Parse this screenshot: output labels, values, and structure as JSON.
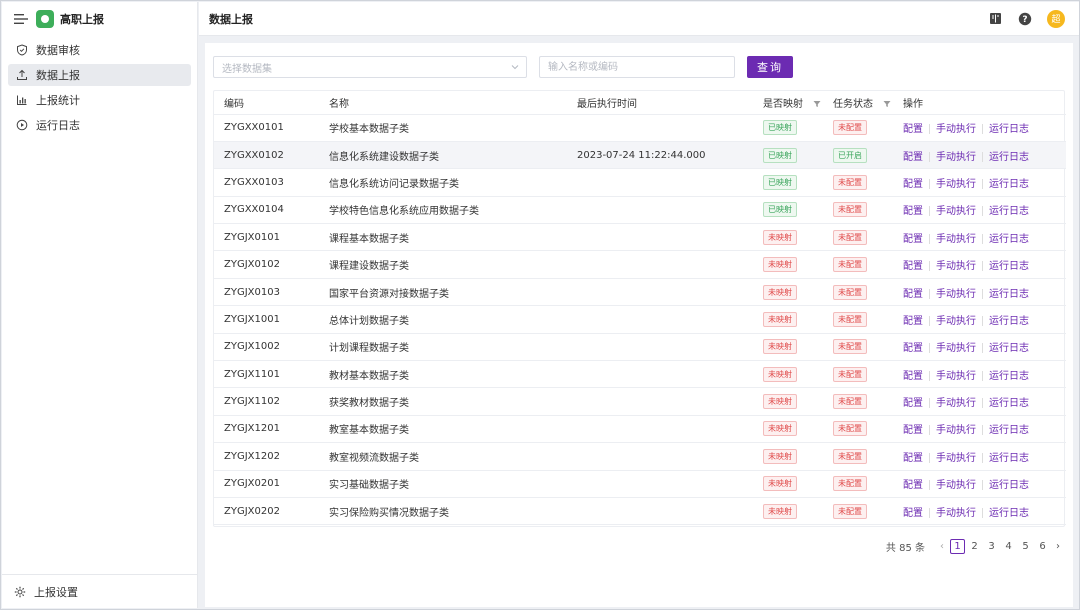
{
  "app": {
    "name": "高职上报"
  },
  "sidebar": {
    "items": [
      {
        "label": "数据审核",
        "icon": "shield-icon",
        "active": false
      },
      {
        "label": "数据上报",
        "icon": "upload-icon",
        "active": true
      },
      {
        "label": "上报统计",
        "icon": "bar-chart-icon",
        "active": false
      },
      {
        "label": "运行日志",
        "icon": "play-circle-icon",
        "active": false
      }
    ],
    "footer_label": "上报设置"
  },
  "header": {
    "title": "数据上报",
    "avatar_text": "超"
  },
  "filters": {
    "select_placeholder": "选择数据集",
    "search_placeholder": "输入名称或编码",
    "query_label": "查询"
  },
  "table": {
    "columns": [
      "编码",
      "名称",
      "最后执行时间",
      "是否映射",
      "任务状态",
      "操作"
    ],
    "ops": [
      "配置",
      "手动执行",
      "运行日志"
    ],
    "rows": [
      {
        "code": "ZYGXX0101",
        "name": "学校基本数据子类",
        "time": "",
        "mapped": "已映射",
        "mapped_ok": true,
        "status": "未配置",
        "status_ok": false
      },
      {
        "code": "ZYGXX0102",
        "name": "信息化系统建设数据子类",
        "time": "2023-07-24 11:22:44.000",
        "mapped": "已映射",
        "mapped_ok": true,
        "status": "已开启",
        "status_ok": true
      },
      {
        "code": "ZYGXX0103",
        "name": "信息化系统访问记录数据子类",
        "time": "",
        "mapped": "已映射",
        "mapped_ok": true,
        "status": "未配置",
        "status_ok": false
      },
      {
        "code": "ZYGXX0104",
        "name": "学校特色信息化系统应用数据子类",
        "time": "",
        "mapped": "已映射",
        "mapped_ok": true,
        "status": "未配置",
        "status_ok": false
      },
      {
        "code": "ZYGJX0101",
        "name": "课程基本数据子类",
        "time": "",
        "mapped": "未映射",
        "mapped_ok": false,
        "status": "未配置",
        "status_ok": false
      },
      {
        "code": "ZYGJX0102",
        "name": "课程建设数据子类",
        "time": "",
        "mapped": "未映射",
        "mapped_ok": false,
        "status": "未配置",
        "status_ok": false
      },
      {
        "code": "ZYGJX0103",
        "name": "国家平台资源对接数据子类",
        "time": "",
        "mapped": "未映射",
        "mapped_ok": false,
        "status": "未配置",
        "status_ok": false
      },
      {
        "code": "ZYGJX1001",
        "name": "总体计划数据子类",
        "time": "",
        "mapped": "未映射",
        "mapped_ok": false,
        "status": "未配置",
        "status_ok": false
      },
      {
        "code": "ZYGJX1002",
        "name": "计划课程数据子类",
        "time": "",
        "mapped": "未映射",
        "mapped_ok": false,
        "status": "未配置",
        "status_ok": false
      },
      {
        "code": "ZYGJX1101",
        "name": "教材基本数据子类",
        "time": "",
        "mapped": "未映射",
        "mapped_ok": false,
        "status": "未配置",
        "status_ok": false
      },
      {
        "code": "ZYGJX1102",
        "name": "获奖教材数据子类",
        "time": "",
        "mapped": "未映射",
        "mapped_ok": false,
        "status": "未配置",
        "status_ok": false
      },
      {
        "code": "ZYGJX1201",
        "name": "教室基本数据子类",
        "time": "",
        "mapped": "未映射",
        "mapped_ok": false,
        "status": "未配置",
        "status_ok": false
      },
      {
        "code": "ZYGJX1202",
        "name": "教室视频流数据子类",
        "time": "",
        "mapped": "未映射",
        "mapped_ok": false,
        "status": "未配置",
        "status_ok": false
      },
      {
        "code": "ZYGJX0201",
        "name": "实习基础数据子类",
        "time": "",
        "mapped": "未映射",
        "mapped_ok": false,
        "status": "未配置",
        "status_ok": false
      },
      {
        "code": "ZYGJX0202",
        "name": "实习保险购买情况数据子类",
        "time": "",
        "mapped": "未映射",
        "mapped_ok": false,
        "status": "未配置",
        "status_ok": false
      }
    ]
  },
  "pagination": {
    "total_text": "共 85 条",
    "pages": [
      "1",
      "2",
      "3",
      "4",
      "5",
      "6"
    ],
    "current": "1"
  },
  "colors": {
    "accent": "#6c2bb2",
    "success": "#3ba55c",
    "danger": "#e04a4a",
    "logo": "#3dae5a",
    "avatar": "#f6b81e"
  }
}
